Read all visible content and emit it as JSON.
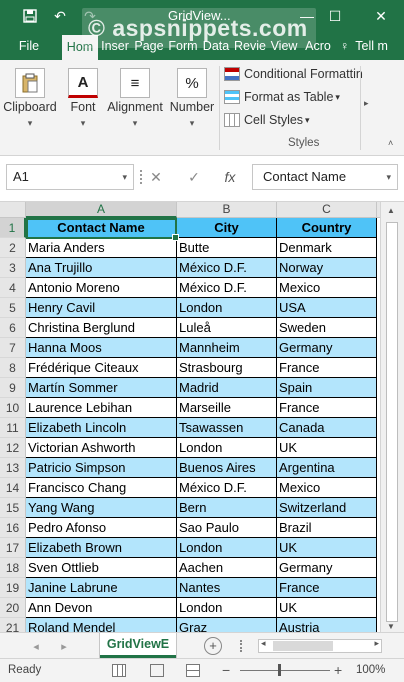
{
  "titlebar": {
    "title": "GridView...",
    "watermark": "© aspsnippets.com",
    "icons": {
      "save": "save-icon",
      "undo": "undo-icon",
      "redo": "redo-icon",
      "minimize": "minimize-icon",
      "maximize": "maximize-icon",
      "close": "close-icon"
    }
  },
  "ribbon": {
    "tabs": [
      "File",
      "Hom",
      "Inser",
      "Page",
      "Form",
      "Data",
      "Revie",
      "View",
      "Acro"
    ],
    "tell_me": "Tell m",
    "groups": {
      "clipboard": "Clipboard",
      "font": "Font",
      "alignment": "Alignment",
      "number": "Number"
    },
    "styles": {
      "conditional": "Conditional Formattin",
      "format_table": "Format as Table",
      "cell_styles": "Cell Styles",
      "label": "Styles"
    }
  },
  "formula_bar": {
    "name_box": "A1",
    "fx": "fx",
    "value": "Contact Name"
  },
  "grid": {
    "columns": [
      "A",
      "B",
      "C"
    ],
    "row_numbers": [
      "1",
      "2",
      "3",
      "4",
      "5",
      "6",
      "7",
      "8",
      "9",
      "10",
      "11",
      "12",
      "13",
      "14",
      "15",
      "16",
      "17",
      "18",
      "19",
      "20",
      "21"
    ],
    "header": [
      "Contact Name",
      "City",
      "Country"
    ],
    "rows": [
      [
        "Maria Anders",
        "Butte",
        "Denmark"
      ],
      [
        "Ana Trujillo",
        "México D.F.",
        "Norway"
      ],
      [
        "Antonio Moreno",
        "México D.F.",
        "Mexico"
      ],
      [
        "Henry Cavil",
        "London",
        "USA"
      ],
      [
        "Christina Berglund",
        "Luleå",
        "Sweden"
      ],
      [
        "Hanna Moos",
        "Mannheim",
        "Germany"
      ],
      [
        "Frédérique Citeaux",
        "Strasbourg",
        "France"
      ],
      [
        "Martín Sommer",
        "Madrid",
        "Spain"
      ],
      [
        "Laurence Lebihan",
        "Marseille",
        "France"
      ],
      [
        "Elizabeth Lincoln",
        "Tsawassen",
        "Canada"
      ],
      [
        "Victorian Ashworth",
        "London",
        "UK"
      ],
      [
        "Patricio Simpson",
        "Buenos Aires",
        "Argentina"
      ],
      [
        "Francisco Chang",
        "México D.F.",
        "Mexico"
      ],
      [
        "Yang Wang",
        "Bern",
        "Switzerland"
      ],
      [
        "Pedro Afonso",
        "Sao Paulo",
        "Brazil"
      ],
      [
        "Elizabeth Brown",
        "London",
        "UK"
      ],
      [
        "Sven Ottlieb",
        "Aachen",
        "Germany"
      ],
      [
        "Janine Labrune",
        "Nantes",
        "France"
      ],
      [
        "Ann Devon",
        "London",
        "UK"
      ],
      [
        "Roland Mendel",
        "Graz",
        "Austria"
      ]
    ]
  },
  "sheets": {
    "active": "GridViewE"
  },
  "status": {
    "ready": "Ready",
    "zoom": "100%"
  },
  "colors": {
    "accent": "#217346",
    "header_fill": "#4fc3f7",
    "alt_row_fill": "#b3e5fc"
  }
}
